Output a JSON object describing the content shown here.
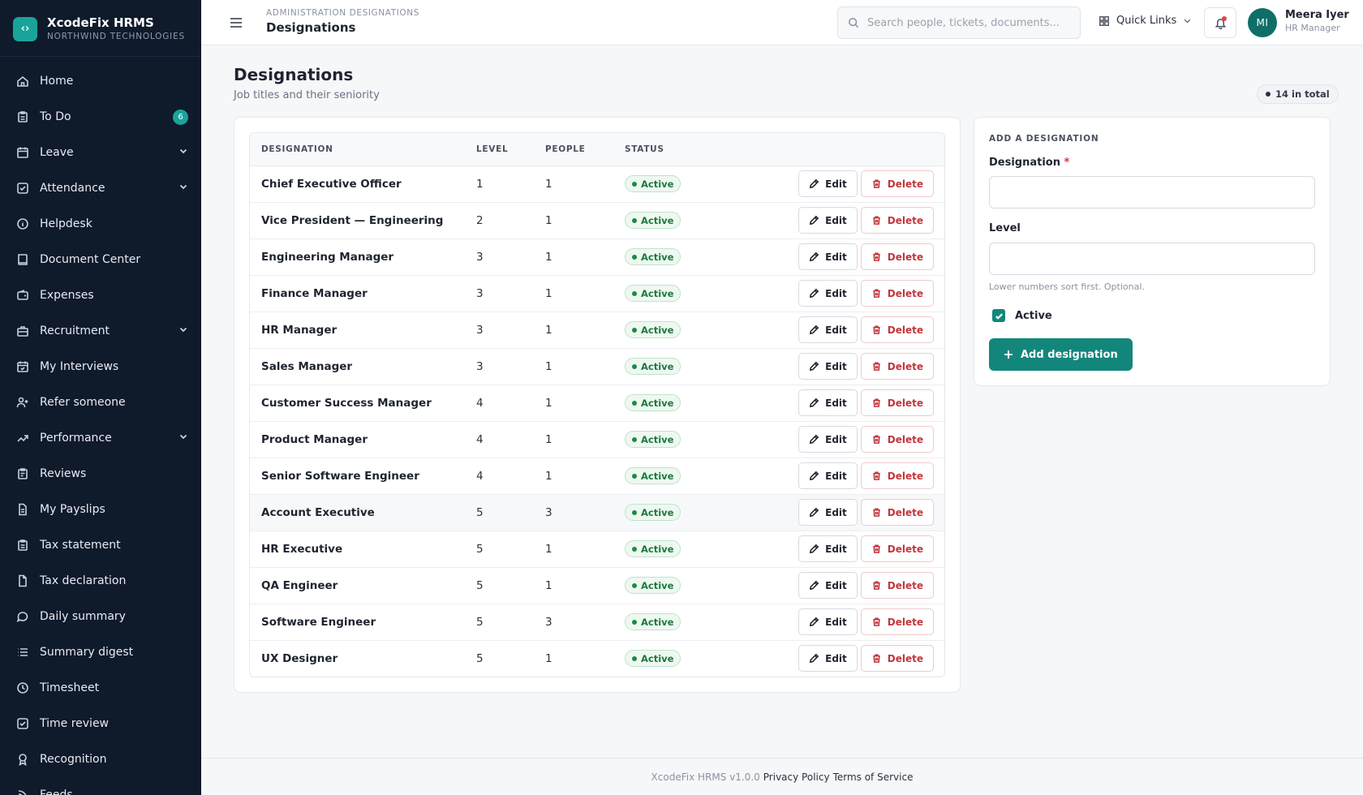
{
  "brand": {
    "name": "XcodeFix HRMS",
    "org": "NORTHWIND TECHNOLOGIES",
    "logo_icon": "code-brackets-icon",
    "accent": "#1aa39a"
  },
  "sidebar": {
    "items": [
      {
        "label": "Home",
        "icon": "home-icon"
      },
      {
        "label": "To Do",
        "icon": "clipboard-icon",
        "badge": "6"
      },
      {
        "label": "Leave",
        "icon": "calendar-icon",
        "expandable": true
      },
      {
        "label": "Attendance",
        "icon": "check-square-icon",
        "expandable": true
      },
      {
        "label": "Helpdesk",
        "icon": "info-circle-icon"
      },
      {
        "label": "Document Center",
        "icon": "book-icon"
      },
      {
        "label": "Expenses",
        "icon": "wallet-icon"
      },
      {
        "label": "Recruitment",
        "icon": "briefcase-icon",
        "expandable": true
      },
      {
        "label": "My Interviews",
        "icon": "calendar-check-icon"
      },
      {
        "label": "Refer someone",
        "icon": "user-plus-icon"
      },
      {
        "label": "Performance",
        "icon": "trending-up-icon",
        "expandable": true
      },
      {
        "label": "Reviews",
        "icon": "clipboard-list-icon"
      },
      {
        "label": "My Payslips",
        "icon": "file-text-icon"
      },
      {
        "label": "Tax statement",
        "icon": "clipboard-icon"
      },
      {
        "label": "Tax declaration",
        "icon": "file-icon"
      },
      {
        "label": "Daily summary",
        "icon": "message-circle-icon"
      },
      {
        "label": "Summary digest",
        "icon": "list-icon"
      },
      {
        "label": "Timesheet",
        "icon": "clock-icon"
      },
      {
        "label": "Time review",
        "icon": "check-square-icon"
      },
      {
        "label": "Recognition",
        "icon": "award-icon"
      },
      {
        "label": "Feeds",
        "icon": "rss-icon"
      }
    ]
  },
  "topbar": {
    "breadcrumb": "ADMINISTRATION DESIGNATIONS",
    "title": "Designations",
    "search_placeholder": "Search people, tickets, documents...",
    "quick_links": "Quick Links",
    "user": {
      "initials": "MI",
      "name": "Meera Iyer",
      "role": "HR Manager"
    }
  },
  "page": {
    "title": "Designations",
    "subtitle": "Job titles and their seniority",
    "total": "14 in total"
  },
  "table": {
    "headers": {
      "designation": "DESIGNATION",
      "level": "LEVEL",
      "people": "PEOPLE",
      "status": "STATUS"
    },
    "edit_label": "Edit",
    "delete_label": "Delete",
    "rows": [
      {
        "name": "Chief Executive Officer",
        "level": "1",
        "people": "1",
        "status": "Active"
      },
      {
        "name": "Vice President — Engineering",
        "level": "2",
        "people": "1",
        "status": "Active"
      },
      {
        "name": "Engineering Manager",
        "level": "3",
        "people": "1",
        "status": "Active"
      },
      {
        "name": "Finance Manager",
        "level": "3",
        "people": "1",
        "status": "Active"
      },
      {
        "name": "HR Manager",
        "level": "3",
        "people": "1",
        "status": "Active"
      },
      {
        "name": "Sales Manager",
        "level": "3",
        "people": "1",
        "status": "Active"
      },
      {
        "name": "Customer Success Manager",
        "level": "4",
        "people": "1",
        "status": "Active"
      },
      {
        "name": "Product Manager",
        "level": "4",
        "people": "1",
        "status": "Active"
      },
      {
        "name": "Senior Software Engineer",
        "level": "4",
        "people": "1",
        "status": "Active"
      },
      {
        "name": "Account Executive",
        "level": "5",
        "people": "3",
        "status": "Active"
      },
      {
        "name": "HR Executive",
        "level": "5",
        "people": "1",
        "status": "Active"
      },
      {
        "name": "QA Engineer",
        "level": "5",
        "people": "1",
        "status": "Active"
      },
      {
        "name": "Software Engineer",
        "level": "5",
        "people": "3",
        "status": "Active"
      },
      {
        "name": "UX Designer",
        "level": "5",
        "people": "1",
        "status": "Active"
      }
    ]
  },
  "form": {
    "heading": "ADD A DESIGNATION",
    "designation_label": "Designation",
    "required_mark": "*",
    "designation_value": "",
    "level_label": "Level",
    "level_value": "",
    "level_hint": "Lower numbers sort first. Optional.",
    "active_label": "Active",
    "active_checked": true,
    "submit_label": "Add designation"
  },
  "footer": {
    "version": "XcodeFix HRMS v1.0.0",
    "privacy": "Privacy Policy",
    "terms": "Terms of Service"
  }
}
